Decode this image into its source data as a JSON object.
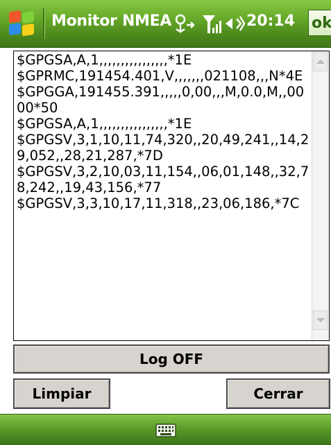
{
  "titlebar": {
    "title": "Monitor NMEA",
    "time": "20:14",
    "ok_label": "ok",
    "icons": [
      "windows-start-icon",
      "connectivity-icon",
      "signal-strength-icon",
      "volume-icon"
    ]
  },
  "log": {
    "lines": [
      "$GPGSA,A,1,,,,,,,,,,,,,,,,*1E",
      "$GPRMC,191454.401,V,,,,,,,021108,,,N*4E",
      "$GPGGA,191455.391,,,,,0,00,,,M,0.0,M,,0000*50",
      "$GPGSA,A,1,,,,,,,,,,,,,,,,*1E",
      "$GPGSV,3,1,10,11,74,320,,20,49,241,,14,29,052,,28,21,287,*7D",
      "$GPGSV,3,2,10,03,11,154,,06,01,148,,32,78,242,,19,43,156,*77",
      "$GPGSV,3,3,10,17,11,318,,23,06,186,*7C"
    ]
  },
  "buttons": {
    "log_label": "Log OFF",
    "clear_label": "Limpiar",
    "close_label": "Cerrar"
  },
  "softbar": {
    "icon": "keyboard-icon"
  },
  "colors": {
    "titlebar_green": "#5a9b26",
    "button_face": "#d7d3ce"
  }
}
